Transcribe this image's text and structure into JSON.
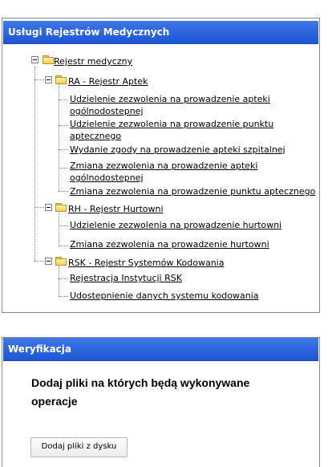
{
  "registries_panel": {
    "title": "Usługi Rejestrów Medycznych",
    "root": {
      "label": "Rejestr medyczny"
    },
    "ra": {
      "label": "RA - Rejestr Aptek",
      "items": [
        "Udzielenie zezwolenia na prowadzenie apteki ogólnodostepnej",
        "Udzielenie zezwolenia na prowadzenie punktu aptecznego",
        "Wydanie zgody na prowadzenie apteki szpitalnej",
        "Zmiana zezwolenia na prowadzenie apteki ogólnodostepnej",
        "Zmiana zezwolenia na prowadzenie punktu aptecznego"
      ],
      "items_lines": {
        "i0_a": "Udzielenie zezwolenia na prowadzenie apteki",
        "i0_b": "ogólnodostepnej",
        "i1_a": "Udzielenie zezwolenia na prowadzenie punktu",
        "i1_b": "aptecznego",
        "i3_a": "Zmiana zezwolenia na prowadzenie apteki",
        "i3_b": "ogólnodostepnej"
      }
    },
    "rh": {
      "label": "RH - Rejestr Hurtowni",
      "items": [
        "Udzielenie zezwolenia na prowadzenie hurtowni",
        "Zmiana zezwolenia na prowadzenie hurtowni"
      ]
    },
    "rsk": {
      "label": "RSK - Rejestr Systemów Kodowania",
      "items": [
        "Rejestracja Instytucji RSK",
        "Udostepnienie danych systemu kodowania"
      ]
    }
  },
  "verification_panel": {
    "title": "Weryfikacja",
    "instruction": "Dodaj pliki na których będą wykonywane operacje",
    "add_button_label": "Dodaj pliki z dysku"
  },
  "colors": {
    "header_top": "#3f78e6",
    "header_bottom": "#1d55d4",
    "folder": "#f2d060"
  },
  "icons": {
    "toggle": "tree-collapse-icon",
    "folder": "folder-icon"
  }
}
